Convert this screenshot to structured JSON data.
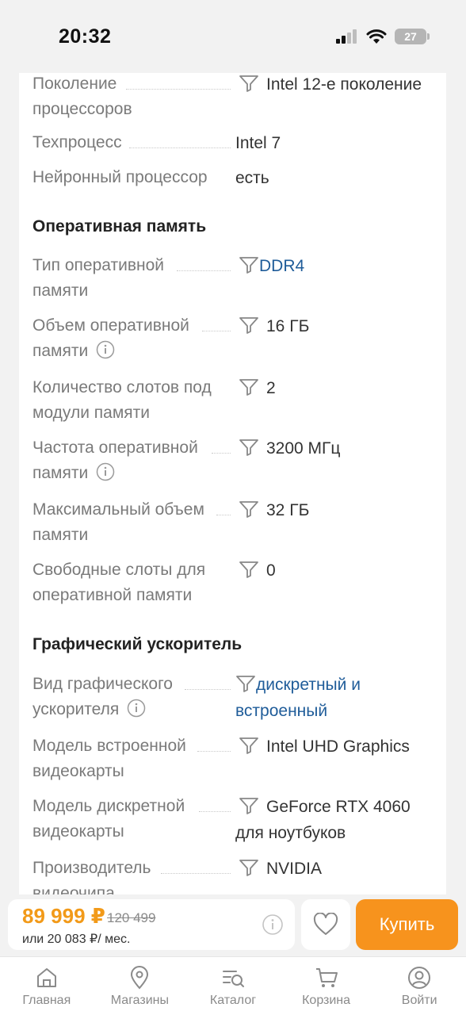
{
  "status": {
    "time": "20:32",
    "battery": "27"
  },
  "specs_top": [
    {
      "label": [
        "Поколение",
        "процессоров"
      ],
      "value": "Intel 12-е поколение",
      "filter": true,
      "link": false
    },
    {
      "label": [
        "Техпроцесс"
      ],
      "value": "Intel 7",
      "filter": false,
      "link": false
    },
    {
      "label": [
        "Нейронный процессор"
      ],
      "value": "есть",
      "filter": false,
      "link": false
    }
  ],
  "sections": {
    "ram": {
      "title": "Оперативная память",
      "items": [
        {
          "label": [
            "Тип оперативной",
            "памяти"
          ],
          "value": [
            "DDR4"
          ],
          "filter": true,
          "link": true,
          "info": false
        },
        {
          "label": [
            "Объем оперативной",
            "памяти"
          ],
          "value": [
            "16 ГБ"
          ],
          "filter": true,
          "link": false,
          "info": true
        },
        {
          "label": [
            "Количество слотов под",
            "модули памяти"
          ],
          "value": [
            "2"
          ],
          "filter": true,
          "link": false,
          "info": false
        },
        {
          "label": [
            "Частота оперативной",
            "памяти"
          ],
          "value": [
            "3200 МГц"
          ],
          "filter": true,
          "link": false,
          "info": true
        },
        {
          "label": [
            "Максимальный объем",
            "памяти"
          ],
          "value": [
            "32 ГБ"
          ],
          "filter": true,
          "link": false,
          "info": false
        },
        {
          "label": [
            "Свободные слоты для",
            "оперативной памяти"
          ],
          "value": [
            "0"
          ],
          "filter": true,
          "link": false,
          "info": false
        }
      ]
    },
    "gpu": {
      "title": "Графический ускоритель",
      "items": [
        {
          "label": [
            "Вид графического",
            "ускорителя"
          ],
          "value": [
            "дискретный и",
            "встроенный"
          ],
          "filter": true,
          "link": true,
          "info": true
        },
        {
          "label": [
            "Модель встроенной",
            "видеокарты"
          ],
          "value": [
            "Intel UHD Graphics"
          ],
          "filter": true,
          "link": false,
          "info": false
        },
        {
          "label": [
            "Модель дискретной",
            "видеокарты"
          ],
          "value": [
            "GeForce RTX 4060",
            "для ноутбуков"
          ],
          "filter": true,
          "link": false,
          "info": false
        },
        {
          "label": [
            "Производитель",
            "видеочипа"
          ],
          "value": [
            "NVIDIA"
          ],
          "filter": true,
          "link": false,
          "info": false
        }
      ]
    }
  },
  "buy_bar": {
    "price": "89 999 ₽",
    "old_price": "120 499",
    "monthly": "или 20 083 ₽/ мес.",
    "buy_label": "Купить"
  },
  "tabs": [
    {
      "label": "Главная",
      "icon": "home-icon"
    },
    {
      "label": "Магазины",
      "icon": "map-pin-icon"
    },
    {
      "label": "Каталог",
      "icon": "catalog-search-icon"
    },
    {
      "label": "Корзина",
      "icon": "cart-icon"
    },
    {
      "label": "Войти",
      "icon": "user-icon"
    }
  ],
  "colors": {
    "accent": "#f7931d",
    "price": "#f29a19",
    "link": "#1f5c99",
    "label": "#7a7a7a"
  }
}
